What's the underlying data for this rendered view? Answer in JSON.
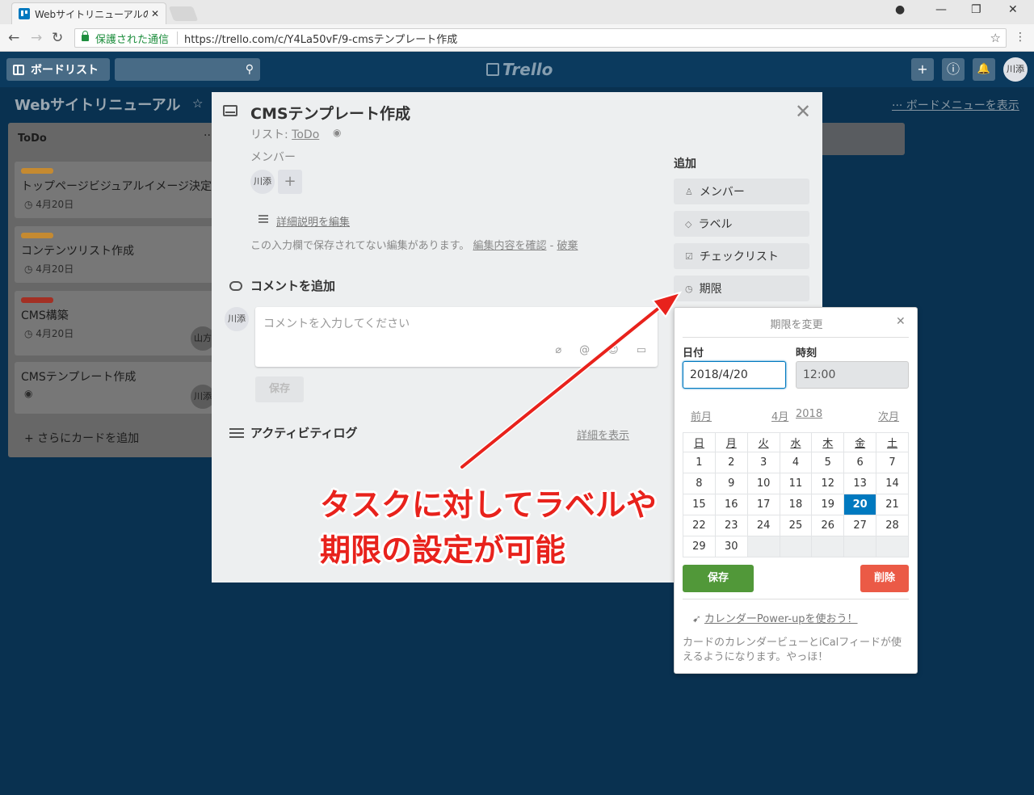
{
  "browser": {
    "tab_title": "Webサイトリニューアルのcm",
    "tab_close": "✕",
    "secure_label": "保護された通信",
    "url": "https://trello.com/c/Y4La50vF/9-cmsテンプレート作成",
    "back": "←",
    "forward": "→",
    "reload": "↻",
    "star": "☆",
    "menu": "⋮",
    "account": "●",
    "minimize": "—",
    "maximize": "❐",
    "close": "✕"
  },
  "header": {
    "boards_label": "ボードリスト",
    "search_icon": "⚲",
    "logo_text": "Trello",
    "add": "+",
    "info": "ⓘ",
    "bell": "🔔",
    "avatar": "川添"
  },
  "board": {
    "title": "Webサイトリニューアル",
    "star": "☆",
    "menu_label": "··· ボードメニューを表示",
    "list": {
      "title": "ToDo",
      "dots": "···",
      "cards": [
        {
          "text": "トップページビジュアルイメージ決定",
          "date": "◷ 4月20日",
          "label_color": "#e8a33a",
          "avatar": ""
        },
        {
          "text": "コンテンツリスト作成",
          "date": "◷ 4月20日",
          "label_color": "#e8a33a",
          "avatar": ""
        },
        {
          "text": "CMS構築",
          "date": "◷ 4月20日",
          "label_color": "#c0392b",
          "avatar": "山方"
        },
        {
          "text": "CMSテンプレート作成",
          "date": "◉",
          "label_color": "",
          "avatar": "川添"
        }
      ],
      "add_card": "+ さらにカードを追加"
    }
  },
  "modal": {
    "title": "CMSテンプレート作成",
    "close": "✕",
    "list_prefix": "リスト: ",
    "list_name": "ToDo",
    "eye": "◉",
    "members_label": "メンバー",
    "member_avatar": "川添",
    "member_add": "+",
    "edit_description": "詳細説明を編集",
    "unsaved_text": "この入力欄で保存されてない編集があります。",
    "view_edits": "編集内容を確認",
    "discard_sep": " - ",
    "discard": "破棄",
    "comment_label": "コメントを追加",
    "comment_avatar": "川添",
    "comment_placeholder": "コメントを入力してください",
    "comment_tools": [
      "⌀",
      "@",
      "☺",
      "▭"
    ],
    "comment_save": "保存",
    "activity_label": "アクティビティログ",
    "activity_link": "詳細を表示",
    "add_label": "追加",
    "sidebar": [
      {
        "icon": "♙",
        "label": "メンバー"
      },
      {
        "icon": "◇",
        "label": "ラベル"
      },
      {
        "icon": "☑",
        "label": "チェックリスト"
      },
      {
        "icon": "◷",
        "label": "期限"
      }
    ]
  },
  "due_popover": {
    "title": "期限を変更",
    "close": "✕",
    "date_label": "日付",
    "time_label": "時刻",
    "date_value": "2018/4/20",
    "time_value": "12:00",
    "prev": "前月",
    "month": "4月",
    "year": "2018",
    "next": "次月",
    "weekdays": [
      "日",
      "月",
      "火",
      "水",
      "木",
      "金",
      "土"
    ],
    "weeks": [
      [
        "1",
        "2",
        "3",
        "4",
        "5",
        "6",
        "7"
      ],
      [
        "8",
        "9",
        "10",
        "11",
        "12",
        "13",
        "14"
      ],
      [
        "15",
        "16",
        "17",
        "18",
        "19",
        "20",
        "21"
      ],
      [
        "22",
        "23",
        "24",
        "25",
        "26",
        "27",
        "28"
      ],
      [
        "29",
        "30",
        "",
        "",
        "",
        "",
        ""
      ]
    ],
    "selected_day": "20",
    "save": "保存",
    "delete": "削除",
    "powerup_icon": "➹",
    "powerup_link": "カレンダーPower-upを使おう！",
    "powerup_desc": "カードのカレンダービューとiCalフィードが使えるようになります。やっほ！"
  },
  "annotation": {
    "line1": "タスクに対してラベルや",
    "line2": "期限の設定が可能",
    "color": "#e8221c"
  }
}
